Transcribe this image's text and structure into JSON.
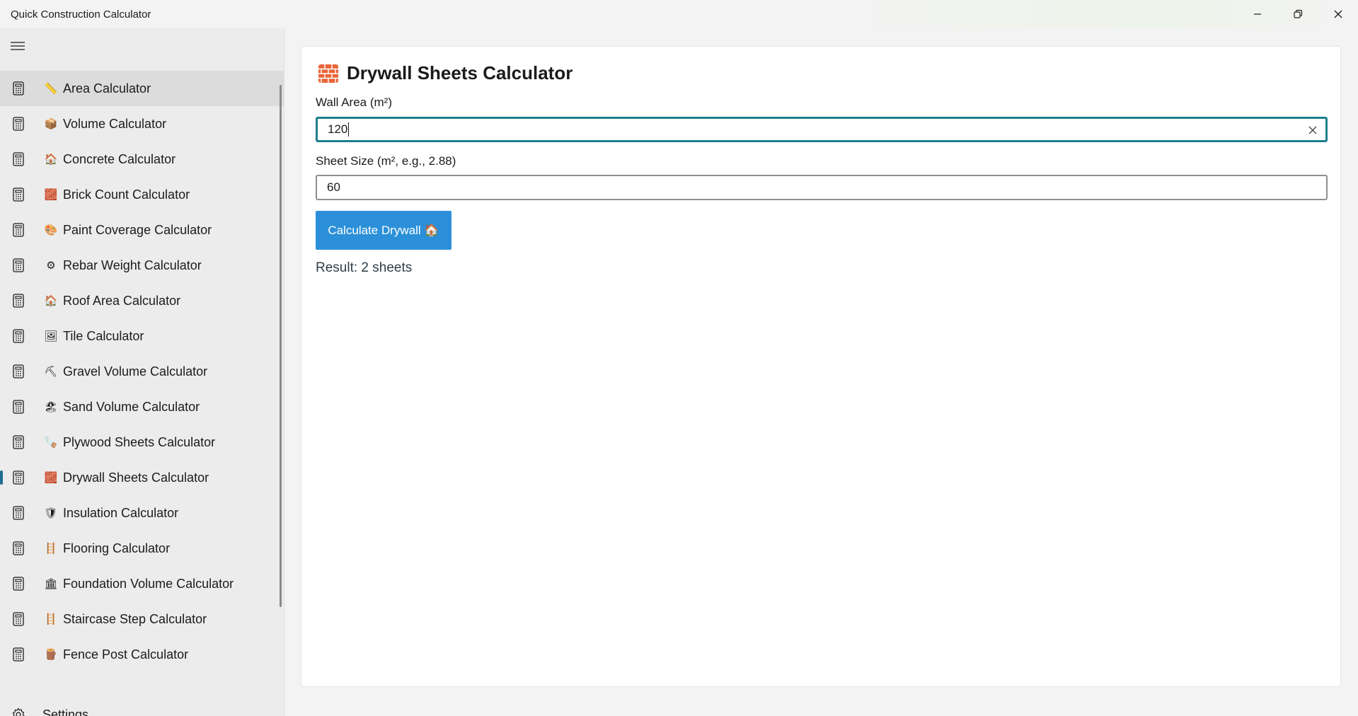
{
  "window": {
    "title": "Quick Construction Calculator"
  },
  "sidebar": {
    "items": [
      {
        "label": "Area Calculator",
        "emoji": "📏"
      },
      {
        "label": "Volume Calculator",
        "emoji": "📦"
      },
      {
        "label": "Concrete Calculator",
        "emoji": "🏠"
      },
      {
        "label": "Brick Count Calculator",
        "emoji": "🧱"
      },
      {
        "label": "Paint Coverage Calculator",
        "emoji": "🎨"
      },
      {
        "label": "Rebar Weight Calculator",
        "emoji": "⚙"
      },
      {
        "label": "Roof Area Calculator",
        "emoji": "🏠"
      },
      {
        "label": "Tile Calculator",
        "emoji": "🖼"
      },
      {
        "label": "Gravel Volume Calculator",
        "emoji": "⛏"
      },
      {
        "label": "Sand Volume Calculator",
        "emoji": "🏖"
      },
      {
        "label": "Plywood Sheets Calculator",
        "emoji": "🪚"
      },
      {
        "label": "Drywall Sheets Calculator",
        "emoji": "🧱"
      },
      {
        "label": "Insulation Calculator",
        "emoji": "🛡"
      },
      {
        "label": "Flooring Calculator",
        "emoji": "🪜"
      },
      {
        "label": "Foundation Volume Calculator",
        "emoji": "🏛"
      },
      {
        "label": "Staircase Step Calculator",
        "emoji": "🪜"
      },
      {
        "label": "Fence Post Calculator",
        "emoji": "🪵"
      }
    ],
    "selected_label": "Drywall Sheets Calculator",
    "settings_label": "Settings"
  },
  "main": {
    "title": "Drywall Sheets Calculator",
    "wall_area_label": "Wall Area (m²)",
    "wall_area_value": "120",
    "sheet_size_label": "Sheet Size (m², e.g., 2.88)",
    "sheet_size_value": "60",
    "button_label": "Calculate Drywall 🏠",
    "result_text": "Result: 2 sheets"
  },
  "colors": {
    "accent": "#2b90d9",
    "focus_border": "#1e7f8f",
    "selection_indicator": "#1e6d8f",
    "brick": "#e8663a"
  }
}
